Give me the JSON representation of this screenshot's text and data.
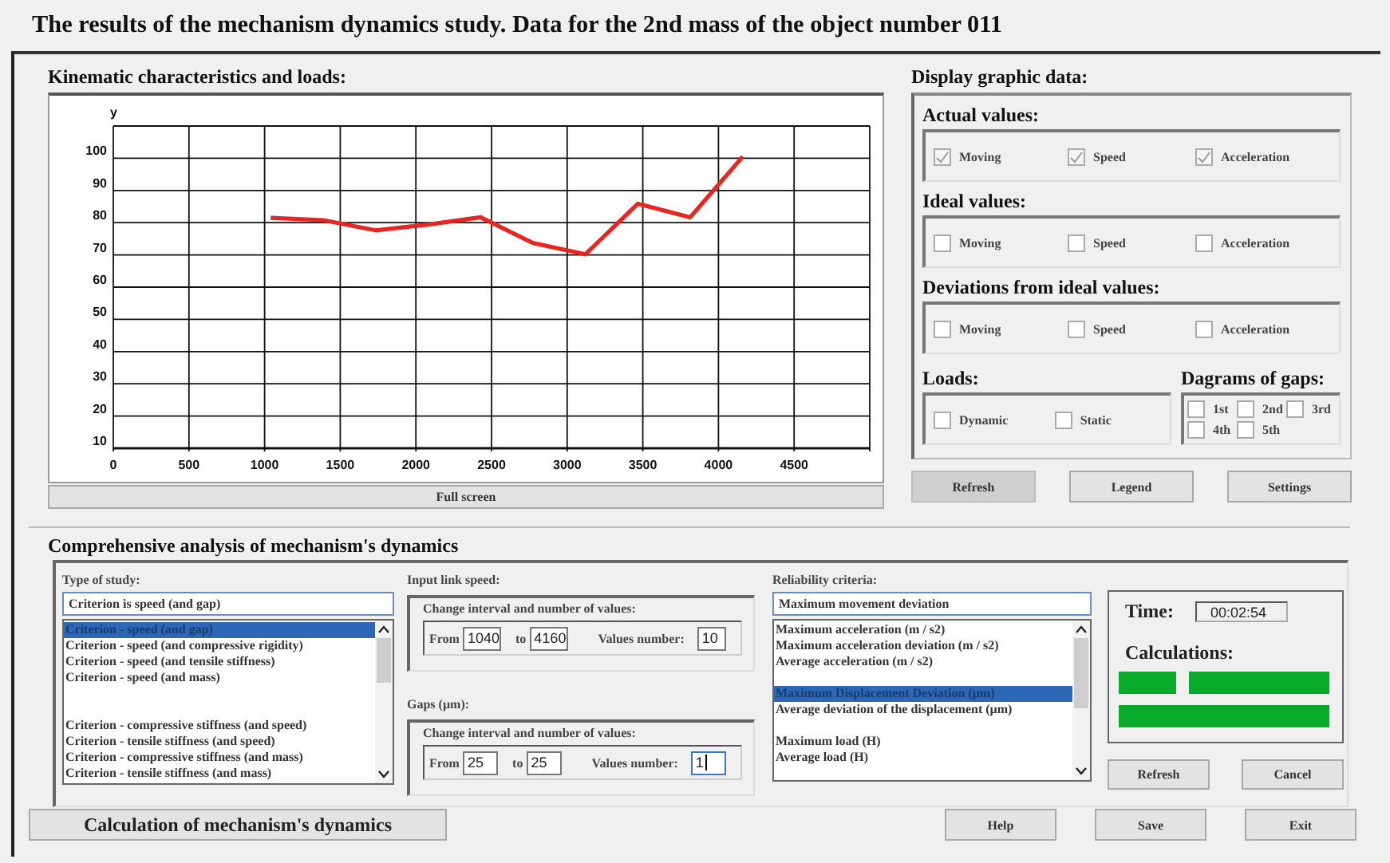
{
  "window": {
    "title": "The results of the mechanism dynamics study. Data for the 2nd mass of the object number 011"
  },
  "kinematics": {
    "title": "Kinematic characteristics and loads:",
    "chart_data": {
      "type": "line",
      "ylabel": "y",
      "x": [
        1040,
        1387,
        1733,
        2080,
        2427,
        2773,
        3120,
        3467,
        3813,
        4160
      ],
      "series": [
        {
          "color": "#e8251f",
          "values": [
            81.5,
            80.8,
            77.6,
            79.4,
            81.7,
            73.7,
            70.2,
            85.9,
            81.7,
            100.5
          ]
        }
      ],
      "grid": true,
      "xlim": [
        0,
        5000
      ],
      "ylim": [
        10,
        110
      ],
      "xticks": [
        0,
        500,
        1000,
        1500,
        2000,
        2500,
        3000,
        3500,
        4000,
        4500
      ],
      "yticks": [
        10,
        20,
        30,
        40,
        50,
        60,
        70,
        80,
        90,
        100
      ]
    },
    "full_screen_button": "Full screen"
  },
  "display": {
    "title": "Display graphic data:",
    "groups": [
      {
        "title": "Actual values:",
        "options": [
          {
            "label": "Moving",
            "checked": true
          },
          {
            "label": "Speed",
            "checked": true
          },
          {
            "label": "Acceleration",
            "checked": true
          }
        ]
      },
      {
        "title": "Ideal values:",
        "options": [
          {
            "label": "Moving",
            "checked": false
          },
          {
            "label": "Speed",
            "checked": false
          },
          {
            "label": "Acceleration",
            "checked": false
          }
        ]
      },
      {
        "title": "Deviations from ideal values:",
        "options": [
          {
            "label": "Moving",
            "checked": false
          },
          {
            "label": "Speed",
            "checked": false
          },
          {
            "label": "Acceleration",
            "checked": false
          }
        ]
      }
    ],
    "loads": {
      "title": "Loads:",
      "options": [
        {
          "label": "Dynamic",
          "checked": false
        },
        {
          "label": "Static",
          "checked": false
        }
      ]
    },
    "gaps": {
      "title": "Dagrams of gaps:",
      "options": [
        {
          "label": "1st",
          "checked": false
        },
        {
          "label": "2nd",
          "checked": false
        },
        {
          "label": "3rd",
          "checked": false
        },
        {
          "label": "4th",
          "checked": false
        },
        {
          "label": "5th",
          "checked": false
        }
      ]
    },
    "buttons": [
      {
        "label": "Refresh",
        "pressed": true
      },
      {
        "label": "Legend",
        "pressed": false
      },
      {
        "label": "Settings",
        "pressed": false
      }
    ]
  },
  "analysis": {
    "title": "Comprehensive analysis of mechanism's dynamics",
    "type_of_study": {
      "label": "Type of study:",
      "value": "Criterion is speed (and gap)",
      "items": [
        {
          "kind": "item",
          "text": "Criterion - speed (and gap)",
          "selected": true
        },
        {
          "kind": "item",
          "text": "Criterion - speed (and compressive rigidity)",
          "selected": false
        },
        {
          "kind": "item",
          "text": "Criterion - speed (and tensile stiffness)",
          "selected": false
        },
        {
          "kind": "item",
          "text": "Criterion - speed (and mass)",
          "selected": false
        },
        {
          "kind": "spacer"
        },
        {
          "kind": "spacer"
        },
        {
          "kind": "item",
          "text": "Criterion - compressive stiffness (and speed)",
          "selected": false
        },
        {
          "kind": "item",
          "text": "Criterion - tensile stiffness (and speed)",
          "selected": false
        },
        {
          "kind": "item",
          "text": "Criterion - compressive stiffness (and mass)",
          "selected": false
        },
        {
          "kind": "item",
          "text": "Criterion - tensile stiffness (and mass)",
          "selected": false
        }
      ]
    },
    "ranges": [
      {
        "label": "Input link speed:",
        "caption": "Change interval and number of values:",
        "from_label": "From",
        "from": "1040",
        "to_label": "to",
        "to": "4160",
        "count_label": "Values number:",
        "count": "10",
        "focused": false
      },
      {
        "label": "Gaps (µm):",
        "caption": "Change interval and number of values:",
        "from_label": "From",
        "from": "25",
        "to_label": "to",
        "to": "25",
        "count_label": "Values number:",
        "count": "1",
        "focused": true
      }
    ],
    "reliability": {
      "label": "Reliability criteria:",
      "value": "Maximum movement deviation",
      "items": [
        {
          "kind": "item",
          "text": "Maximum acceleration (m / s2)",
          "selected": false
        },
        {
          "kind": "item",
          "text": "Maximum acceleration deviation (m / s2)",
          "selected": false
        },
        {
          "kind": "item",
          "text": "Average acceleration (m / s2)",
          "selected": false
        },
        {
          "kind": "spacer"
        },
        {
          "kind": "item",
          "text": "Maximum Displacement Deviation (µm)",
          "selected": true
        },
        {
          "kind": "item",
          "text": "Average deviation of the displacement (µm)",
          "selected": false
        },
        {
          "kind": "spacer"
        },
        {
          "kind": "item",
          "text": "Maximum load (H)",
          "selected": false
        },
        {
          "kind": "item",
          "text": "Average load (H)",
          "selected": false
        }
      ]
    },
    "status": {
      "time_label": "Time:",
      "time": "00:02:54",
      "calculations_label": "Calculations:"
    },
    "buttons": [
      "Refresh",
      "Cancel"
    ]
  },
  "footer": {
    "main_button": "Calculation of mechanism's dynamics",
    "buttons": [
      "Help",
      "Save",
      "Exit"
    ]
  }
}
